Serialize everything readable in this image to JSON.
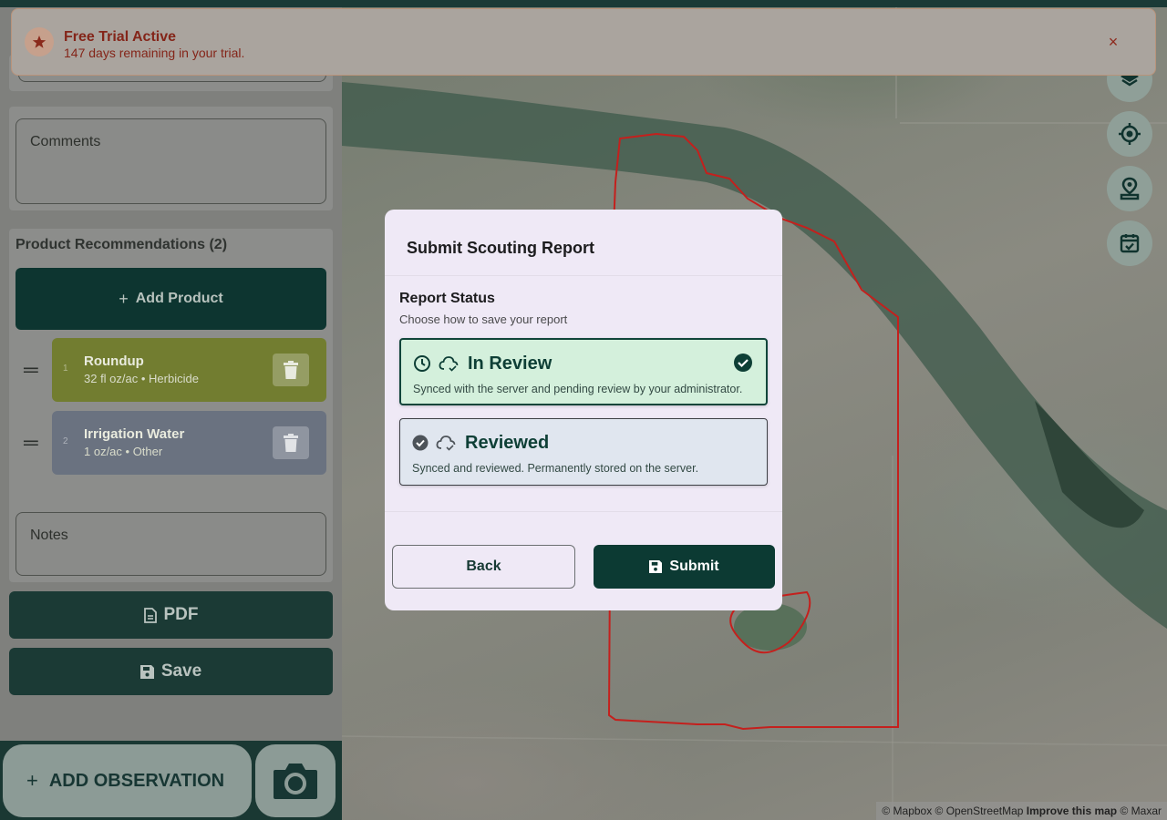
{
  "trial": {
    "title": "Free Trial Active",
    "subtitle": "147 days remaining in your trial.",
    "close": "×"
  },
  "sidebar": {
    "comments_placeholder": "Comments",
    "product_section_title": "Product Recommendations (2)",
    "add_product_label": "Add Product",
    "products": [
      {
        "index": "1",
        "name": "Roundup",
        "detail": "32 fl oz/ac • Herbicide",
        "color": "#727d30"
      },
      {
        "index": "2",
        "name": "Irrigation Water",
        "detail": "1 oz/ac • Other",
        "color": "#6a7280"
      }
    ],
    "notes_placeholder": "Notes",
    "pdf_label": "PDF",
    "save_label": "Save",
    "add_observation_label": "ADD OBSERVATION"
  },
  "modal": {
    "title": "Submit Scouting Report",
    "section_label": "Report Status",
    "section_hint": "Choose how to save your report",
    "options": [
      {
        "title": "In Review",
        "description": "Synced with the server and pending review by your administrator.",
        "selected": true
      },
      {
        "title": "Reviewed",
        "description": "Synced and reviewed. Permanently stored on the server.",
        "selected": false
      }
    ],
    "back_label": "Back",
    "submit_label": "Submit"
  },
  "map": {
    "attribution_prefix": "© Mapbox © OpenStreetMap",
    "attribution_link": "Improve this map",
    "attribution_suffix": "© Maxar",
    "boundary_color": "#c4201d"
  }
}
